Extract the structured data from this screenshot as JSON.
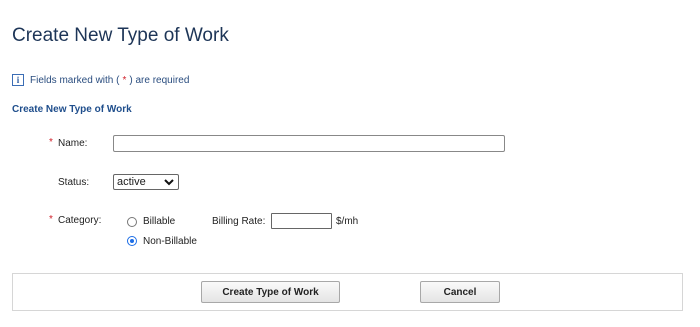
{
  "page": {
    "title": "Create New Type of Work",
    "info_prefix": "Fields marked with (",
    "info_star": "*",
    "info_suffix": ") are required",
    "section_title": "Create New Type of Work"
  },
  "form": {
    "required_marker": "*",
    "name_label": "Name:",
    "name_value": "",
    "status_label": "Status:",
    "status_value": "active",
    "category_label": "Category:",
    "category_options": [
      {
        "label": "Billable",
        "checked": false
      },
      {
        "label": "Non-Billable",
        "checked": true
      }
    ],
    "billing_rate_label": "Billing Rate:",
    "billing_rate_value": "",
    "billing_rate_unit": "$/mh"
  },
  "actions": {
    "create_label": "Create Type of Work",
    "cancel_label": "Cancel"
  },
  "colors": {
    "title": "#1d3557",
    "section_title": "#1f4e8c",
    "required_star": "#d0202a",
    "radio_selected": "#1d6ee6"
  },
  "icons": {
    "info": "info-icon",
    "dropdown": "chevron-down-icon"
  }
}
